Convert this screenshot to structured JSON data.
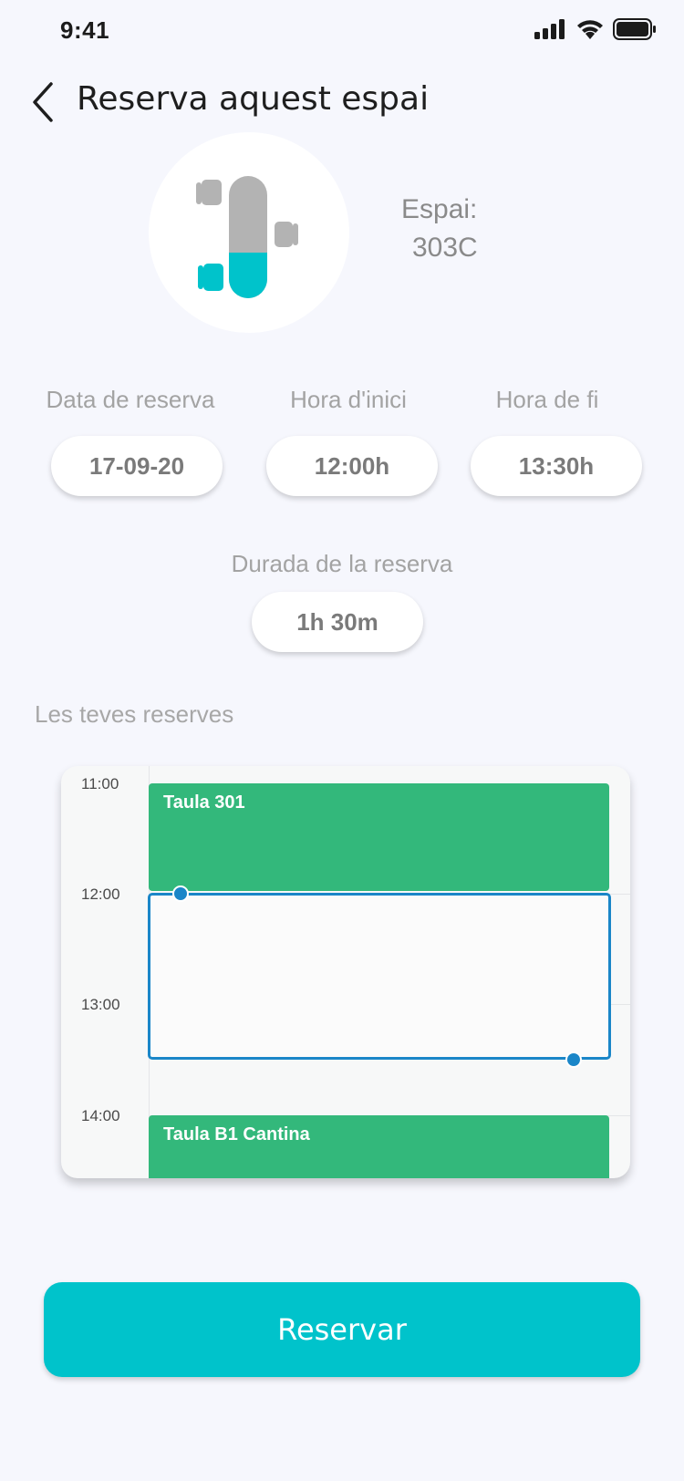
{
  "status_bar": {
    "time": "9:41"
  },
  "header": {
    "title": "Reserva aquest espai"
  },
  "space": {
    "label": "Espai:",
    "code": "303C"
  },
  "fields": {
    "date": {
      "label": "Data de reserva",
      "value": "17-09-20"
    },
    "start": {
      "label": "Hora d'inici",
      "value": "12:00h"
    },
    "end": {
      "label": "Hora de fi",
      "value": "13:30h"
    },
    "duration": {
      "label": "Durada de la reserva",
      "value": "1h 30m"
    }
  },
  "reservations": {
    "title": "Les teves reserves",
    "hours": [
      "11:00",
      "12:00",
      "13:00",
      "14:00"
    ],
    "events": [
      {
        "name": "Taula 301"
      },
      {
        "name": "Taula B1 Cantina"
      }
    ]
  },
  "action": {
    "reserve_label": "Reservar"
  },
  "colors": {
    "accent": "#00c3cb",
    "event_green": "#33b87b",
    "selection_blue": "#1a86c8"
  }
}
